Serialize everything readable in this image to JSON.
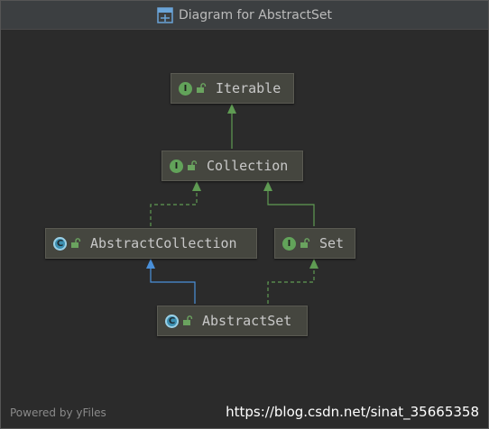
{
  "window": {
    "title": "Diagram for AbstractSet",
    "icon": "uml-diagram-icon"
  },
  "nodes": {
    "iterable": {
      "label": "Iterable",
      "kind": "interface",
      "badge": "I"
    },
    "collection": {
      "label": "Collection",
      "kind": "interface",
      "badge": "I"
    },
    "abstract_collection": {
      "label": "AbstractCollection",
      "kind": "abstract-class",
      "badge": "C"
    },
    "set": {
      "label": "Set",
      "kind": "interface",
      "badge": "I"
    },
    "abstract_set": {
      "label": "AbstractSet",
      "kind": "abstract-class",
      "badge": "C"
    }
  },
  "edges": [
    {
      "from": "Collection",
      "to": "Iterable",
      "type": "extends",
      "style": "solid"
    },
    {
      "from": "AbstractCollection",
      "to": "Collection",
      "type": "implements",
      "style": "dashed"
    },
    {
      "from": "Set",
      "to": "Collection",
      "type": "extends",
      "style": "solid"
    },
    {
      "from": "AbstractSet",
      "to": "AbstractCollection",
      "type": "extends",
      "style": "solid"
    },
    {
      "from": "AbstractSet",
      "to": "Set",
      "type": "implements",
      "style": "dashed"
    }
  ],
  "colors": {
    "background": "#2b2b2b",
    "node_fill": "#45463f",
    "interface_edge": "#5f9b53",
    "class_edge": "#4a90d9"
  },
  "footer": {
    "powered_by": "Powered by yFiles",
    "watermark": "https://blog.csdn.net/sinat_35665358"
  }
}
